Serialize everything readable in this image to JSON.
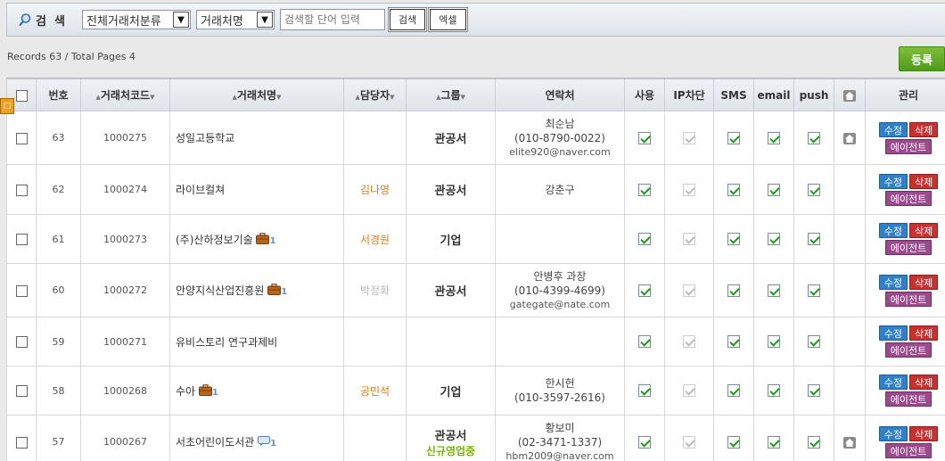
{
  "search": {
    "label": "검  색",
    "category_select": "전체거래처분류",
    "field_select": "거래처명",
    "input_placeholder": "검색할 단어 입력",
    "search_button": "검색",
    "excel_button": "엑셀"
  },
  "records_info": "Records 63 / Total Pages 4",
  "register_button": "등록",
  "side_tab": "□",
  "columns": {
    "num": "번호",
    "code": "거래처코드",
    "name": "거래처명",
    "manager": "담당자",
    "group": "그룹",
    "contact": "연락처",
    "use": "사용",
    "ip_block": "IP차단",
    "sms": "SMS",
    "email": "email",
    "push": "push",
    "manage": "관리"
  },
  "action_labels": {
    "edit": "수정",
    "delete": "삭제",
    "agent": "에이전트"
  },
  "icons": {
    "briefcase": "briefcase-icon",
    "chat": "chat-icon",
    "home": "home-icon",
    "search": "magnifier-icon"
  },
  "rows": [
    {
      "num": "63",
      "code": "1000275",
      "name": "성일고등학교",
      "suffix": "",
      "suffix_icon": "",
      "manager": "",
      "manager_style": "",
      "group": "관공서",
      "group_sub": "",
      "contact_name": "최순남",
      "contact_phone": "(010-8790-0022)",
      "contact_email": "elite920@naver.com",
      "home": true
    },
    {
      "num": "62",
      "code": "1000274",
      "name": "라이브컬쳐",
      "suffix": "",
      "suffix_icon": "",
      "manager": "김나영",
      "manager_style": "orange",
      "group": "관공서",
      "group_sub": "",
      "contact_name": "강춘구",
      "contact_phone": "",
      "contact_email": "",
      "home": false
    },
    {
      "num": "61",
      "code": "1000273",
      "name": "(주)산하정보기술",
      "suffix": "1",
      "suffix_icon": "briefcase",
      "manager": "서경원",
      "manager_style": "orange",
      "group": "기업",
      "group_sub": "",
      "contact_name": "",
      "contact_phone": "",
      "contact_email": "",
      "home": false
    },
    {
      "num": "60",
      "code": "1000272",
      "name": "안양지식산업진흥원",
      "suffix": "1",
      "suffix_icon": "briefcase",
      "manager": "박정화",
      "manager_style": "gray",
      "group": "관공서",
      "group_sub": "",
      "contact_name": "안병후 과장",
      "contact_phone": "(010-4399-4699)",
      "contact_email": "gategate@nate.com",
      "home": false
    },
    {
      "num": "59",
      "code": "1000271",
      "name": "유비스토리 연구과제비",
      "suffix": "",
      "suffix_icon": "",
      "manager": "",
      "manager_style": "",
      "group": "",
      "group_sub": "",
      "contact_name": "",
      "contact_phone": "",
      "contact_email": "",
      "home": false
    },
    {
      "num": "58",
      "code": "1000268",
      "name": "수아",
      "suffix": "1",
      "suffix_icon": "briefcase",
      "manager": "공민석",
      "manager_style": "orange",
      "group": "기업",
      "group_sub": "",
      "contact_name": "한시헌",
      "contact_phone": "(010-3597-2616)",
      "contact_email": "",
      "home": false
    },
    {
      "num": "57",
      "code": "1000267",
      "name": "서초어린이도서관",
      "suffix": "1",
      "suffix_icon": "chat",
      "manager": "",
      "manager_style": "",
      "group": "관공서",
      "group_sub": "신규영업중",
      "contact_name": "황보미",
      "contact_phone": "(02-3471-1337)",
      "contact_email": "hbm2009@naver.com",
      "home": true
    }
  ]
}
